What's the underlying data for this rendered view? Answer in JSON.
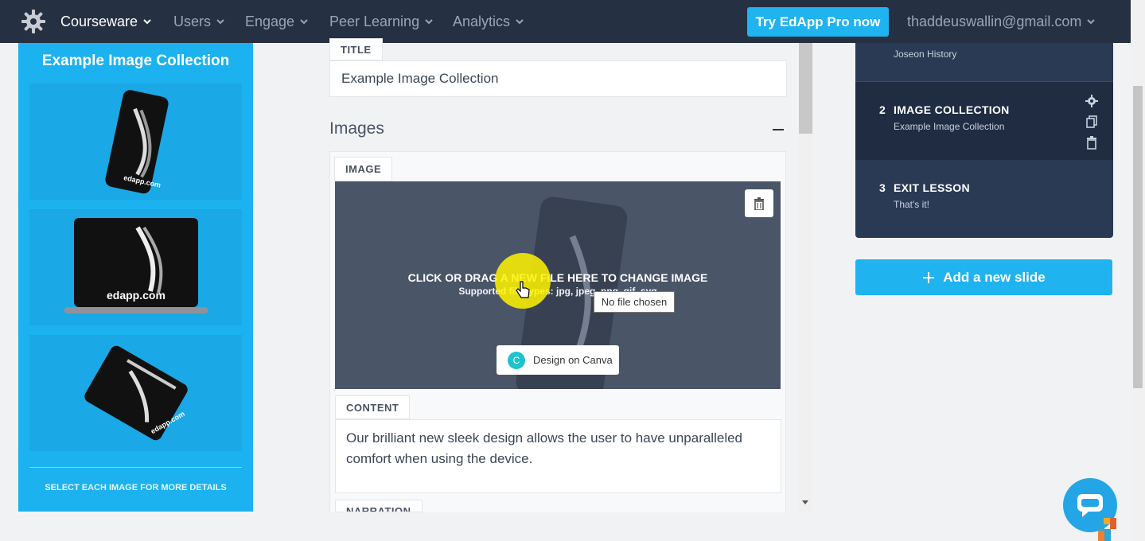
{
  "nav": {
    "items": [
      {
        "label": "Courseware",
        "active": true
      },
      {
        "label": "Users",
        "active": false
      },
      {
        "label": "Engage",
        "active": false
      },
      {
        "label": "Peer Learning",
        "active": false
      },
      {
        "label": "Analytics",
        "active": false
      }
    ],
    "pro_button": "Try EdApp Pro now",
    "user_email": "thaddeuswallin@gmail.com"
  },
  "preview": {
    "title": "Example Image Collection",
    "images": [
      {
        "brand": "edapp.com",
        "device": "phone"
      },
      {
        "brand": "edapp.com",
        "device": "laptop"
      },
      {
        "brand": "edapp.com",
        "device": "tablet"
      }
    ],
    "footer": "SELECT EACH IMAGE FOR MORE DETAILS"
  },
  "editor": {
    "title_label": "TITLE",
    "title_value": "Example Image Collection",
    "images_heading": "Images",
    "image_label": "IMAGE",
    "drop_text": "CLICK OR DRAG A NEW FILE HERE TO CHANGE IMAGE",
    "drop_sub": "Supported file types: jpg, jpeg, png, gif, svg",
    "tooltip": "No file chosen",
    "canva_button": "Design on Canva",
    "content_label": "CONTENT",
    "content_value": "Our brilliant new sleek design allows the user to have unparalleled comfort when using the device.",
    "narration_label": "NARRATION"
  },
  "slides": [
    {
      "number": "",
      "title": "",
      "subtitle": "Joseon History",
      "active": false
    },
    {
      "number": "2",
      "title": "IMAGE COLLECTION",
      "subtitle": "Example Image Collection",
      "active": true
    },
    {
      "number": "3",
      "title": "EXIT LESSON",
      "subtitle": "That's it!",
      "active": false
    }
  ],
  "add_slide": "Add a new slide",
  "colors": {
    "nav_bg": "#253042",
    "accent": "#1fb3f0",
    "preview_bg": "#1bb2ef",
    "slides_bg": "#2a3a55",
    "slides_active": "#1f2c42"
  }
}
